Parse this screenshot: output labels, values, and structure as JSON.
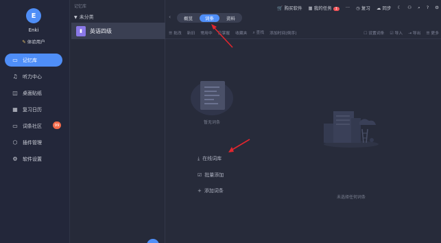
{
  "user": {
    "avatar_letter": "E",
    "name": "Enki",
    "type": "体验用户"
  },
  "sidebar": {
    "items": [
      {
        "label": "记忆库",
        "icon": "library-icon",
        "active": true
      },
      {
        "label": "听力中心",
        "icon": "music-note-icon"
      },
      {
        "label": "桌面贴纸",
        "icon": "sticker-icon"
      },
      {
        "label": "复习日历",
        "icon": "calendar-icon"
      },
      {
        "label": "词条社区",
        "icon": "chat-icon",
        "badge": "99"
      },
      {
        "label": "插件管理",
        "icon": "cube-icon"
      },
      {
        "label": "软件设置",
        "icon": "settings-icon"
      }
    ]
  },
  "library": {
    "title": "记忆库",
    "category": "未分类",
    "book_name": "英语四级"
  },
  "topbar": {
    "buy": "购买软件",
    "tasks": "我的任务",
    "tasks_badge": "1",
    "more": "···",
    "review": "复习",
    "sync": "同步"
  },
  "tabs": [
    "概览",
    "词条",
    "资料"
  ],
  "toolbar": {
    "items": [
      "☰ 批改",
      "新旧",
      "常用中",
      "已掌握",
      "收藏夹",
      "⌕ 查找",
      "添加时间(倒序)",
      "☐ 设置词条",
      "☑ 导入",
      "⇥ 导出",
      "☰ 更多"
    ]
  },
  "empty": {
    "message": "暂无词条",
    "online": "在线词库",
    "batch": "批量添加",
    "add": "添加词条"
  },
  "right_panel": {
    "message": "未选择任何词条"
  },
  "colors": {
    "accent": "#4f8ef7",
    "badge": "#f26a4a",
    "arrow": "#e3262e"
  }
}
